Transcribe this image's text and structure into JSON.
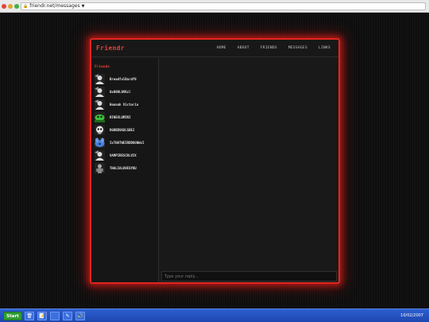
{
  "browser": {
    "url": "friendr.net/messages",
    "dropdown_glyph": "▼",
    "lock_icon": "🔒"
  },
  "app": {
    "logo": "Friendr",
    "accent_color": "#e0251f",
    "nav": [
      "HOME",
      "ABOUT",
      "FRIENDS",
      "MESSAGES",
      "LINKS"
    ]
  },
  "sidebar": {
    "title": "Friends",
    "friends": [
      {
        "name": "BreadfulBardf9",
        "avatar": "default-silhouette"
      },
      {
        "name": "0x000L0VKxl",
        "avatar": "default-silhouette"
      },
      {
        "name": "Hannah Victoria",
        "avatar": "default-silhouette"
      },
      {
        "name": "RINEXLUMINI",
        "avatar": "green-creature"
      },
      {
        "name": "DGRBDSKULSBEJ",
        "avatar": "skull"
      },
      {
        "name": "IxTHATWEIRDDOGNWxI",
        "avatar": "blue-dog"
      },
      {
        "name": "VAMPIRESCRLVIX",
        "avatar": "default-silhouette"
      },
      {
        "name": "THALIALOVESYOU",
        "avatar": "gray-figure"
      }
    ]
  },
  "reply": {
    "placeholder": "Type your reply..."
  },
  "taskbar": {
    "start_label": "Start",
    "icons": [
      "trash-icon",
      "notepad-icon",
      "blank-window-icon",
      "pen-icon",
      "speaker-icon"
    ],
    "icon_glyphs": [
      "🗑",
      "📝",
      "",
      "✎",
      "🔊"
    ],
    "clock": "10/02/2007"
  }
}
